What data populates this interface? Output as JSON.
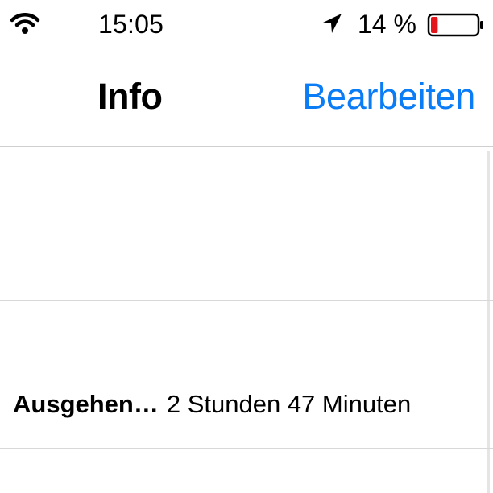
{
  "status_bar": {
    "time": "15:05",
    "battery_percent": "14 %",
    "icons": [
      "wifi-icon",
      "location-arrow-icon",
      "battery-icon"
    ],
    "battery_level": 0.14,
    "battery_color": "#e4151b"
  },
  "nav": {
    "title": "Info",
    "edit_label": "Bearbeiten",
    "accent_color": "#0a7cf6"
  },
  "rows": [
    {
      "label": "Ausgehen…",
      "value": "2 Stunden 47 Minuten"
    }
  ]
}
